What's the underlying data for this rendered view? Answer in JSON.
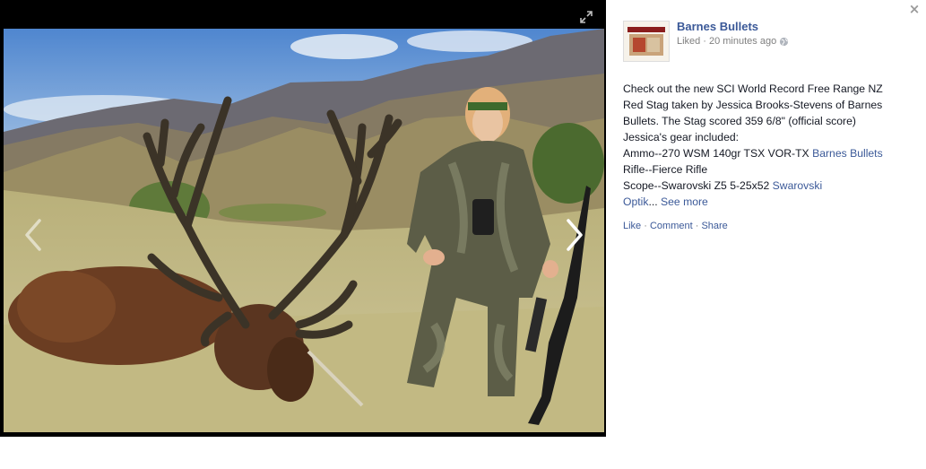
{
  "post": {
    "page_name": "Barnes Bullets",
    "liked": "Liked",
    "time": "20 minutes ago",
    "lines": [
      "Check out the new SCI World Record Free Range NZ",
      "Red Stag taken by Jessica Brooks-Stevens of Barnes",
      "Bullets. The Stag scored 359 6/8\" (official score)",
      "Jessica's gear included:"
    ],
    "ammo_text": "Ammo--270 WSM 140gr TSX VOR-TX ",
    "ammo_link": "Barnes Bullets",
    "rifle_text": "Rifle--Fierce Rifle",
    "scope_text": "Scope--Swarovski Z5 5-25x52 ",
    "scope_link": "Swarovski",
    "optik_link": "Optik",
    "ellipsis": "... ",
    "see_more": "See more",
    "actions": {
      "like": "Like",
      "comment": "Comment",
      "share": "Share",
      "sep": " · "
    }
  },
  "viewer": {
    "close": "×"
  },
  "icons": {
    "expand": "expand-icon",
    "prev": "chevron-left-icon",
    "next": "chevron-right-icon",
    "globe": "globe-icon",
    "close": "close-icon"
  },
  "colors": {
    "link": "#3b5998",
    "meta": "#7f7f7f",
    "stage": "#000000"
  }
}
